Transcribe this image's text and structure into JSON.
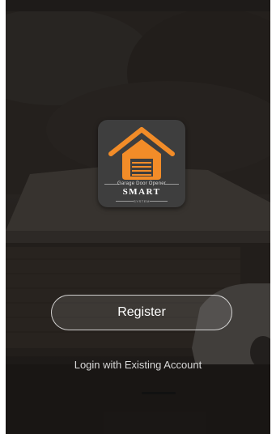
{
  "status_bar": {
    "left": "",
    "right": ""
  },
  "app_icon": {
    "caption_top": "Garage Door Opener",
    "caption_main": "SMART",
    "caption_sub": "SYSTEM",
    "icon_color": "#F28C28"
  },
  "actions": {
    "register_label": "Register",
    "login_label": "Login with Existing Account"
  }
}
